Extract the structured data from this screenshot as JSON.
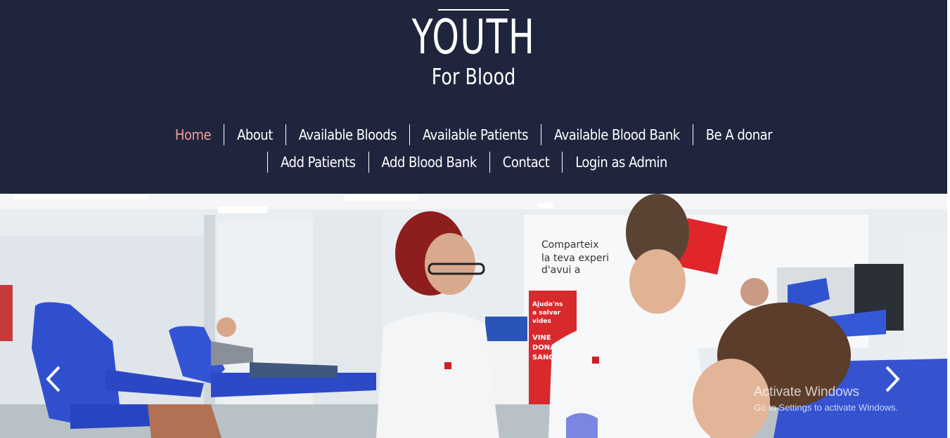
{
  "brand": {
    "title": "YOUTH",
    "subtitle": "For Blood"
  },
  "nav": {
    "row1": [
      {
        "label": "Home",
        "active": true
      },
      {
        "label": "About"
      },
      {
        "label": "Available Bloods"
      },
      {
        "label": "Available Patients"
      },
      {
        "label": "Available Blood Bank"
      },
      {
        "label": "Be A donar"
      }
    ],
    "row2": [
      {
        "label": "Add Patients"
      },
      {
        "label": "Add Blood Bank"
      },
      {
        "label": "Contact"
      },
      {
        "label": "Login as Admin"
      }
    ]
  },
  "hero": {
    "poster_text": "Comparteix la teva experiència d'avui a",
    "sign_text": "Ajuda'ns a salvar vides",
    "sign_text2": "VINE A DONAR SANG",
    "prev_icon": "chevron-left-icon",
    "next_icon": "chevron-right-icon"
  },
  "watermark": {
    "title": "Activate Windows",
    "subtitle": "Go to Settings to activate Windows."
  },
  "colors": {
    "header_bg": "#1f253d",
    "nav_active": "#f19c9b",
    "nav_text": "#ffffff"
  }
}
